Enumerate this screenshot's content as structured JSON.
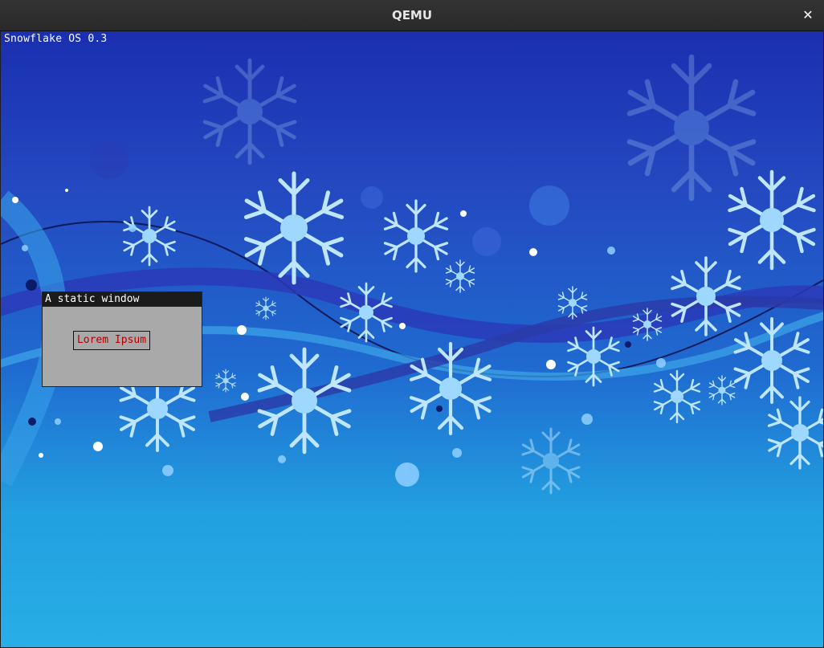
{
  "window": {
    "title": "QEMU",
    "close_glyph": "✕"
  },
  "desktop": {
    "os_label": "Snowflake OS 0.3",
    "wallpaper": "blue-snowflake-wallpaper"
  },
  "static_window": {
    "title": "A static window",
    "button_label": "Lorem Ipsum"
  },
  "colors": {
    "title_bar": "#2a2a2a",
    "window_title_bar": "#1b1b1b",
    "window_body": "#a9a9a9",
    "button_text": "#b00000"
  }
}
